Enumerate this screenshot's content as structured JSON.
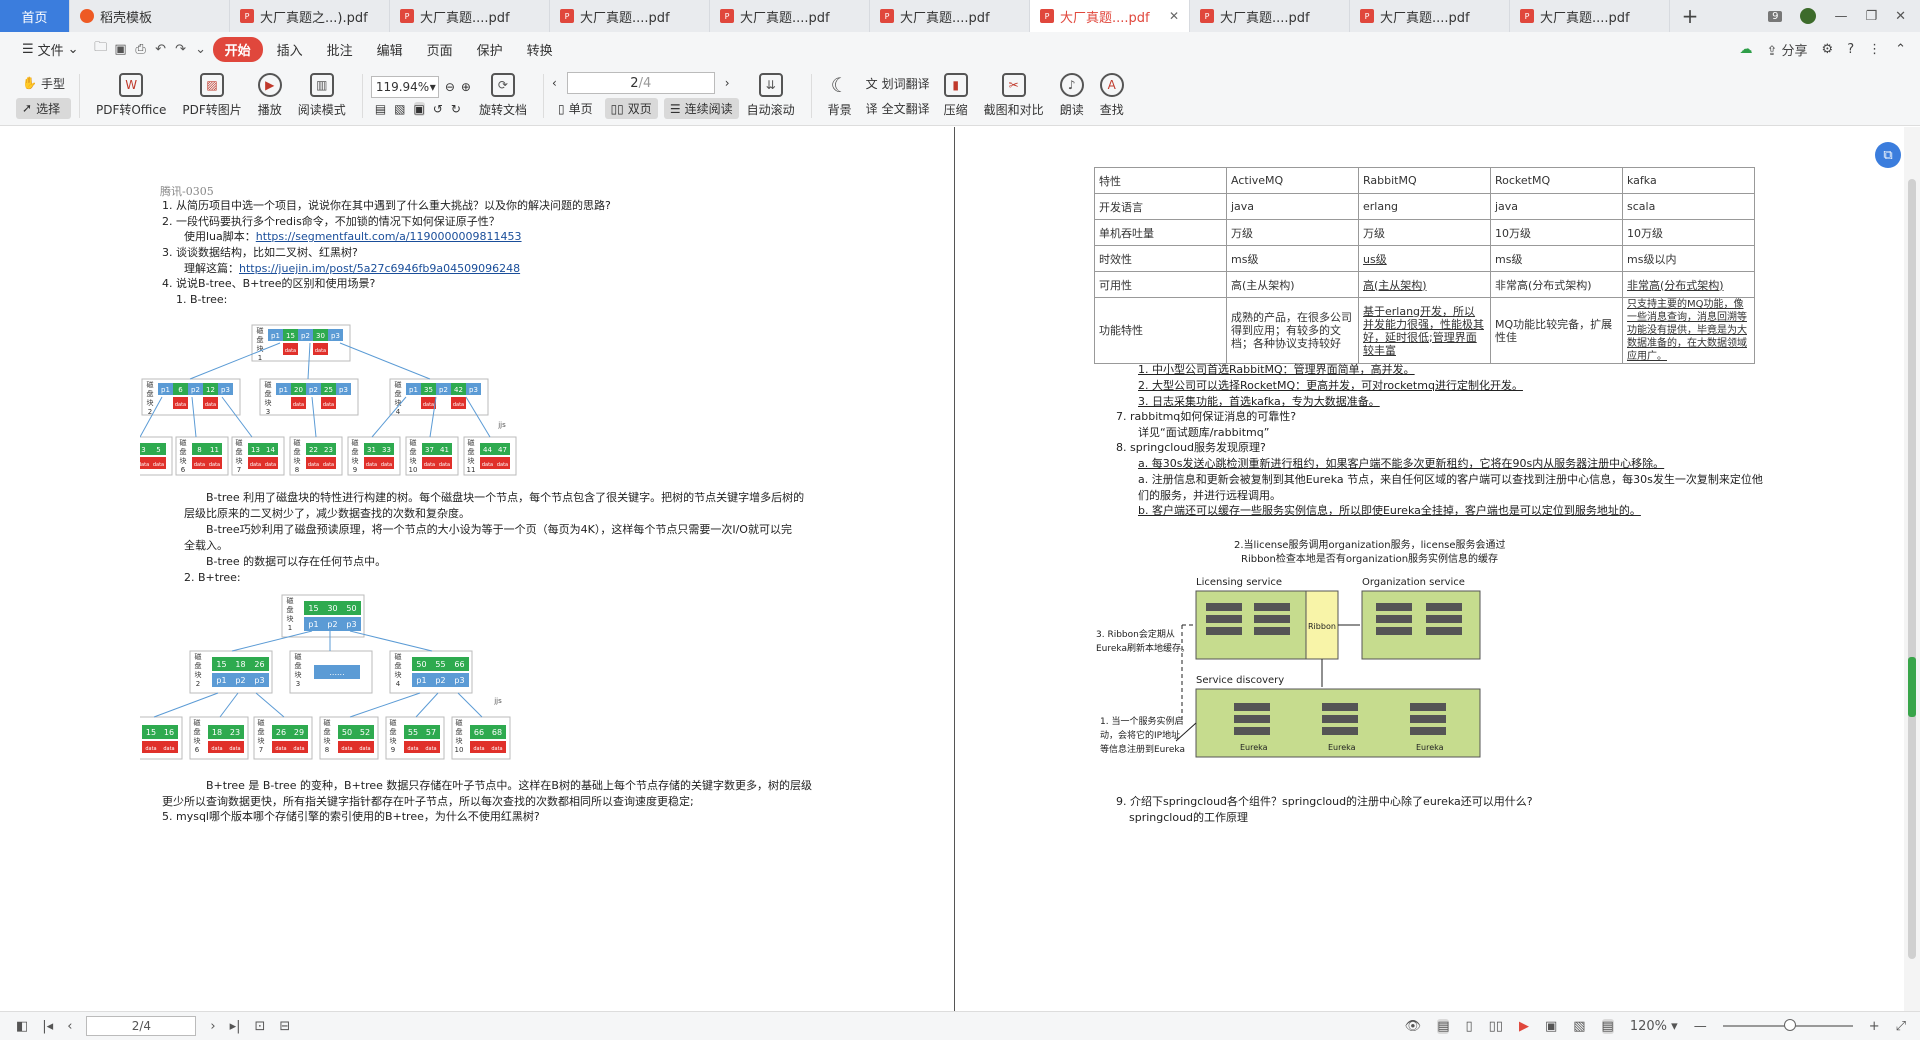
{
  "tabs": {
    "home": "首页",
    "items": [
      {
        "label": "稻壳模板",
        "icon": "daoke-icon"
      },
      {
        "label": "大厂真题之...).pdf",
        "icon": "pdf-icon"
      },
      {
        "label": "大厂真题....pdf",
        "icon": "pdf-icon"
      },
      {
        "label": "大厂真题....pdf",
        "icon": "pdf-icon"
      },
      {
        "label": "大厂真题....pdf",
        "icon": "pdf-icon"
      },
      {
        "label": "大厂真题....pdf",
        "icon": "pdf-icon"
      },
      {
        "label": "大厂真题....pdf",
        "icon": "pdf-icon",
        "active": true
      },
      {
        "label": "大厂真题....pdf",
        "icon": "pdf-icon"
      },
      {
        "label": "大厂真题....pdf",
        "icon": "pdf-icon"
      },
      {
        "label": "大厂真题....pdf",
        "icon": "pdf-icon"
      }
    ],
    "badge": "9"
  },
  "menu": {
    "file": "文件",
    "items": [
      "开始",
      "插入",
      "批注",
      "编辑",
      "页面",
      "保护",
      "转换"
    ],
    "share": "分享"
  },
  "toolbar": {
    "hand": "手型",
    "select": "选择",
    "pdf_to_office": "PDF转Office",
    "pdf_to_image": "PDF转图片",
    "play": "播放",
    "read_mode": "阅读模式",
    "zoom": "119.94%",
    "rotate_doc": "旋转文档",
    "page_current": "2",
    "page_total": "/4",
    "single": "单页",
    "double": "双页",
    "continuous": "连续阅读",
    "auto_scroll": "自动滚动",
    "background": "背景",
    "word_translate": "划词翻译",
    "full_translate": "全文翻译",
    "compress": "压缩",
    "screenshot_compare": "截图和对比",
    "read_aloud": "朗读",
    "find": "查找"
  },
  "left_page": {
    "header": "腾讯-0305",
    "lines": [
      "1. 从简历项目中选一个项目，说说你在其中遇到了什么重大挑战？以及你的解决问题的思路?",
      "2. 一段代码要执行多个redis命令，不加锁的情况下如何保证原子性？",
      "使用lua脚本：",
      "https://segmentfault.com/a/1190000009811453",
      "3. 谈谈数据结构，比如二叉树、红黑树?",
      "理解这篇：",
      "https://juejin.im/post/5a27c6946fb9a04509096248",
      "4. 说说B-tree、B+tree的区别和使用场景?",
      "1. B-tree:",
      "B-tree 利用了磁盘块的特性进行构建的树。每个磁盘块一个节点，每个节点包含了很关键字。把树的节点关键字增多后树的",
      "层级比原来的二叉树少了，减少数据查找的次数和复杂度。",
      "B-tree巧妙利用了磁盘预读原理，将一个节点的大小设为等于一个页（每页为4K），这样每个节点只需要一次I/O就可以完",
      "全载入。",
      "B-tree 的数据可以存在任何节点中。",
      "2. B+tree:",
      "B+tree 是 B-tree 的变种，B+tree 数据只存储在叶子节点中。这样在B树的基础上每个节点存储的关键字数更多，树的层级",
      "更少所以查询数据更快，所有指关键字指针都存在叶子节点，所以每次查找的次数都相同所以查询速度更稳定;",
      "5. mysql哪个版本哪个存储引擎的索引使用的B+tree，为什么不使用红黑树?"
    ],
    "btree_label": "磁盘块",
    "btree_nodes": [
      {
        "keys": [
          "p1",
          "15",
          "p2",
          "30",
          "p3"
        ],
        "id": "1"
      },
      {
        "keys": [
          "p1",
          "6",
          "p2",
          "12",
          "p3"
        ],
        "id": "2"
      },
      {
        "keys": [
          "p1",
          "20",
          "p2",
          "25",
          "p3"
        ],
        "id": "3"
      },
      {
        "keys": [
          "p1",
          "35",
          "p2",
          "42",
          "p3"
        ],
        "id": "4"
      },
      {
        "keys": [
          "3",
          "5"
        ],
        "id": "5"
      },
      {
        "keys": [
          "8",
          "11"
        ],
        "id": "6"
      },
      {
        "keys": [
          "13",
          "14"
        ],
        "id": "7"
      },
      {
        "keys": [
          "22",
          "23"
        ],
        "id": "8"
      },
      {
        "keys": [
          "31",
          "33"
        ],
        "id": "9"
      },
      {
        "keys": [
          "37",
          "41"
        ],
        "id": "10"
      },
      {
        "keys": [
          "44",
          "47"
        ],
        "id": "11"
      }
    ],
    "bplus_nodes": [
      {
        "keys": [
          "15",
          "30",
          "50"
        ],
        "id": "1"
      },
      {
        "keys": [
          "15",
          "18",
          "26"
        ],
        "id": "2"
      },
      {
        "keys": [
          "......"
        ],
        "id": "3"
      },
      {
        "keys": [
          "50",
          "55",
          "66"
        ],
        "id": "4"
      },
      {
        "keys": [
          "15",
          "16"
        ],
        "id": "5"
      },
      {
        "keys": [
          "18",
          "23"
        ],
        "id": "6"
      },
      {
        "keys": [
          "26",
          "29"
        ],
        "id": "7"
      },
      {
        "keys": [
          "50",
          "52"
        ],
        "id": "8"
      },
      {
        "keys": [
          "55",
          "57"
        ],
        "id": "9"
      },
      {
        "keys": [
          "66",
          "68"
        ],
        "id": "10"
      }
    ],
    "data_label": "data",
    "ptr_labels": [
      "p1",
      "p2",
      "p3"
    ],
    "tag_jjs": "jjs"
  },
  "right_page": {
    "table_header": [
      "特性",
      "ActiveMQ",
      "RabbitMQ",
      "RocketMQ",
      "kafka"
    ],
    "table_rows": [
      [
        "开发语言",
        "java",
        "erlang",
        "java",
        "scala"
      ],
      [
        "单机吞吐量",
        "万级",
        "万级",
        "10万级",
        "10万级"
      ],
      [
        "时效性",
        "ms级",
        "us级",
        "ms级",
        "ms级以内"
      ],
      [
        "可用性",
        "高(主从架构)",
        "高(主从架构)",
        "非常高(分布式架构)",
        "非常高(分布式架构)"
      ],
      [
        "功能特性",
        "成熟的产品，在很多公司得到应用；有较多的文档；各种协议支持较好",
        "基于erlang开发，所以并发能力很强，性能极其好，延时很低;管理界面较丰富",
        "MQ功能比较完备，扩展性佳",
        "只支持主要的MQ功能，像一些消息查询，消息回溯等功能没有提供，毕竟是为大数据准备的，在大数据领域应用广。"
      ]
    ],
    "lines": [
      "1. 中小型公司首选RabbitMQ：管理界面简单，高并发。",
      "2. 大型公司可以选择RocketMQ：更高并发，可对rocketmq进行定制化开发。",
      "3. 日志采集功能，首选kafka，专为大数据准备。",
      "7. rabbitmq如何保证消息的可靠性?",
      "详见“面试题库/rabbitmq”",
      "8. springcloud服务发现原理?",
      "a. 每30s发送心跳检测重新进行租约，如果客户端不能多次更新租约，它将在90s内从服务器注册中心移除。",
      "a. 注册信息和更新会被复制到其他Eureka 节点，来自任何区域的客户端可以查找到注册中心信息，每30s发生一次复制来定位他",
      "们的服务，并进行远程调用。",
      "b. 客户端还可以缓存一些服务实例信息，所以即使Eureka全挂掉，客户端也是可以定位到服务地址的。",
      "9. 介绍下springcloud各个组件？springcloud的注册中心除了eureka还可以用什么?",
      "springcloud的工作原理"
    ],
    "diagram": {
      "note_top": "2.当license服务调用organization服务，license服务会通过",
      "note_top2": "Ribbon检查本地是否有organization服务实例信息的缓存",
      "licensing": "Licensing service",
      "organization": "Organization service",
      "ribbon": "Ribbon",
      "service_discovery": "Service discovery",
      "eureka": "Eureka",
      "note3a": "3. Ribbon会定期从",
      "note3b": "Eureka刷新本地缓存。",
      "note1a": "1. 当一个服务实例启",
      "note1b": "动，会将它的IP地址",
      "note1c": "等信息注册到Eureka"
    }
  },
  "status": {
    "page": "2/4",
    "zoom": "120%",
    "zoom_level": 0.52
  }
}
